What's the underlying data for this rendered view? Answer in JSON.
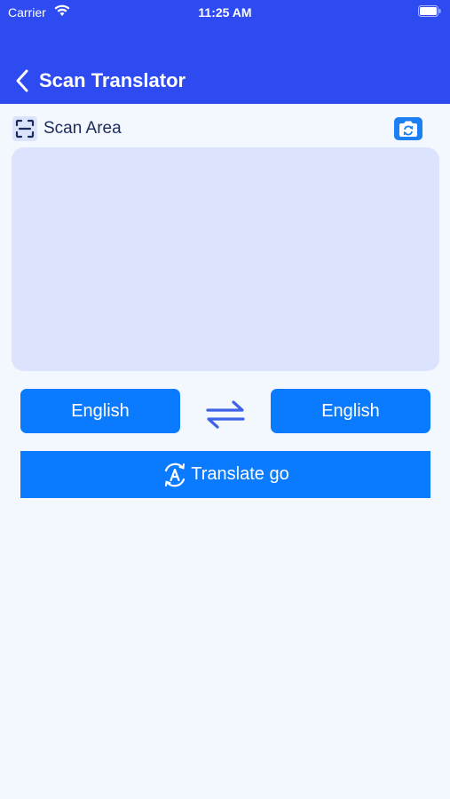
{
  "status_bar": {
    "carrier": "Carrier",
    "time": "11:25 AM"
  },
  "nav": {
    "title": "Scan Translator",
    "back_icon": "chevron-left-icon"
  },
  "scan": {
    "label": "Scan Area",
    "frame_icon": "scan-frame-icon",
    "camera_icon": "camera-switch-icon"
  },
  "languages": {
    "source": "English",
    "target": "English",
    "swap_icon": "swap-arrows-icon"
  },
  "translate": {
    "label": "Translate go",
    "icon": "translate-icon"
  },
  "colors": {
    "header": "#2d4bf0",
    "accent": "#0a7afe",
    "scan_area": "#dbe3fd",
    "background": "#f3f7fe"
  }
}
